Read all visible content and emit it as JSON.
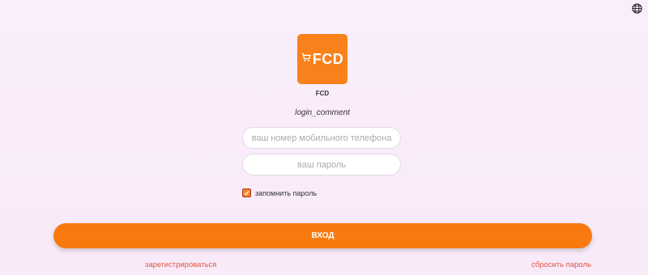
{
  "header": {
    "language_icon": "globe-icon"
  },
  "brand": {
    "logo_text": "FCD",
    "logo_icon": "cart-icon",
    "name": "FCD",
    "color": "#f8811b"
  },
  "login": {
    "comment": "login_comment",
    "phone_placeholder": "ваш номер мобильного телефона",
    "phone_value": "",
    "password_placeholder": "ваш пароль",
    "password_value": "",
    "remember_label": "запомнить пароль",
    "remember_checked": true,
    "submit_label": "ВХОД",
    "register_link": "зарегистрироваться",
    "reset_link": "сбросить пароль"
  },
  "colors": {
    "accent": "#f87a0f",
    "link": "#e25544",
    "background": "#fbeefb"
  }
}
